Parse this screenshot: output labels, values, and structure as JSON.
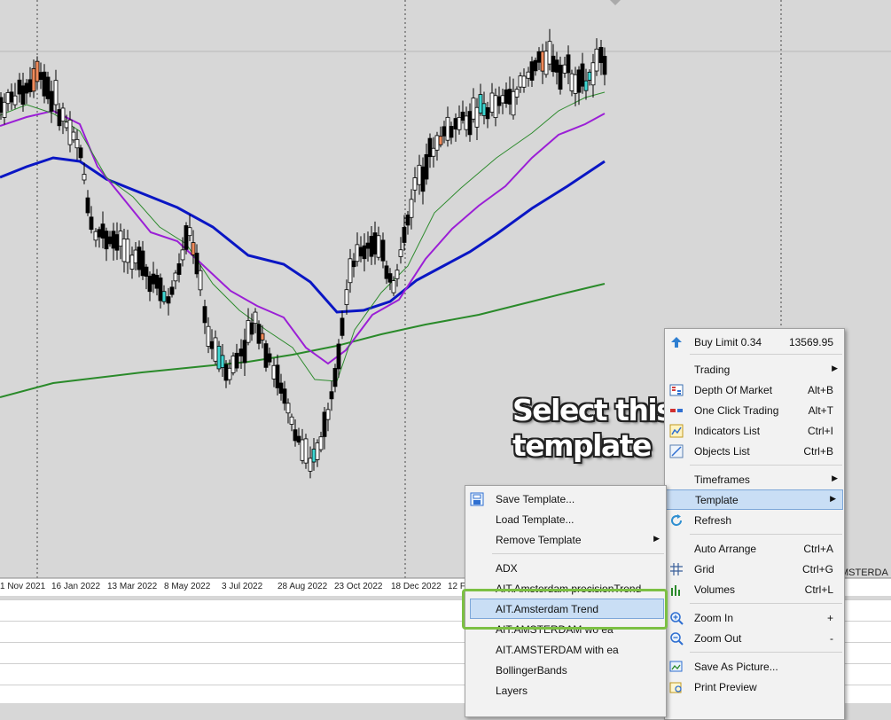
{
  "chart": {
    "x_labels": [
      "1 Nov 2021",
      "16 Jan 2022",
      "13 Mar 2022",
      "8 May 2022",
      "3 Jul 2022",
      "28 Aug 2022",
      "23 Oct 2022",
      "18 Dec 2022",
      "12 F"
    ],
    "symbol_fragment": "MSTERDA",
    "colors": {
      "background": "#d7d7d7",
      "bull_candle": "#ffffff",
      "bear_candle": "#000000",
      "ma_fast": "#2e8b2e",
      "ma_mid": "#9b1fd6",
      "ma_slow": "#0a16c4",
      "ma_long": "#2a8a2a",
      "highlight_orange": "#f08a5a",
      "highlight_cyan": "#3fd6d2"
    }
  },
  "callout": {
    "line1": "Select this",
    "line2": "template"
  },
  "context_menu": {
    "items": [
      {
        "label": "Buy Limit 0.34",
        "shortcut": "13569.95",
        "icon": "buy-limit-arrow-icon"
      },
      {
        "label": "Trading",
        "submenu": true
      },
      {
        "label": "Depth Of Market",
        "shortcut": "Alt+B",
        "icon": "depth-of-market-icon"
      },
      {
        "label": "One Click Trading",
        "shortcut": "Alt+T",
        "icon": "one-click-trading-icon"
      },
      {
        "label": "Indicators List",
        "shortcut": "Ctrl+I",
        "icon": "indicators-list-icon"
      },
      {
        "label": "Objects List",
        "shortcut": "Ctrl+B",
        "icon": "objects-list-icon"
      },
      {
        "label": "Timeframes",
        "submenu": true
      },
      {
        "label": "Template",
        "submenu": true,
        "highlighted": true
      },
      {
        "label": "Refresh",
        "icon": "refresh-icon"
      },
      {
        "label": "Auto Arrange",
        "shortcut": "Ctrl+A"
      },
      {
        "label": "Grid",
        "shortcut": "Ctrl+G",
        "icon": "grid-icon"
      },
      {
        "label": "Volumes",
        "shortcut": "Ctrl+L",
        "icon": "volumes-icon"
      },
      {
        "label": "Zoom In",
        "shortcut": "+",
        "icon": "zoom-in-icon"
      },
      {
        "label": "Zoom Out",
        "shortcut": "-",
        "icon": "zoom-out-icon"
      },
      {
        "label": "Save As Picture...",
        "icon": "save-picture-icon"
      },
      {
        "label": "Print Preview",
        "icon": "print-preview-icon"
      }
    ]
  },
  "template_submenu": {
    "items": [
      {
        "label": "Save Template...",
        "icon": "save-template-icon"
      },
      {
        "label": "Load Template..."
      },
      {
        "label": "Remove Template",
        "submenu": true
      },
      {
        "label": "ADX"
      },
      {
        "label": "AIT.Amsterdam precisionTrend"
      },
      {
        "label": "AIT.Amsterdam Trend",
        "highlighted": true
      },
      {
        "label": "AIT.AMSTERDAM wo ea"
      },
      {
        "label": "AIT.AMSTERDAM with ea"
      },
      {
        "label": "BollingerBands"
      },
      {
        "label": "Layers"
      }
    ]
  }
}
